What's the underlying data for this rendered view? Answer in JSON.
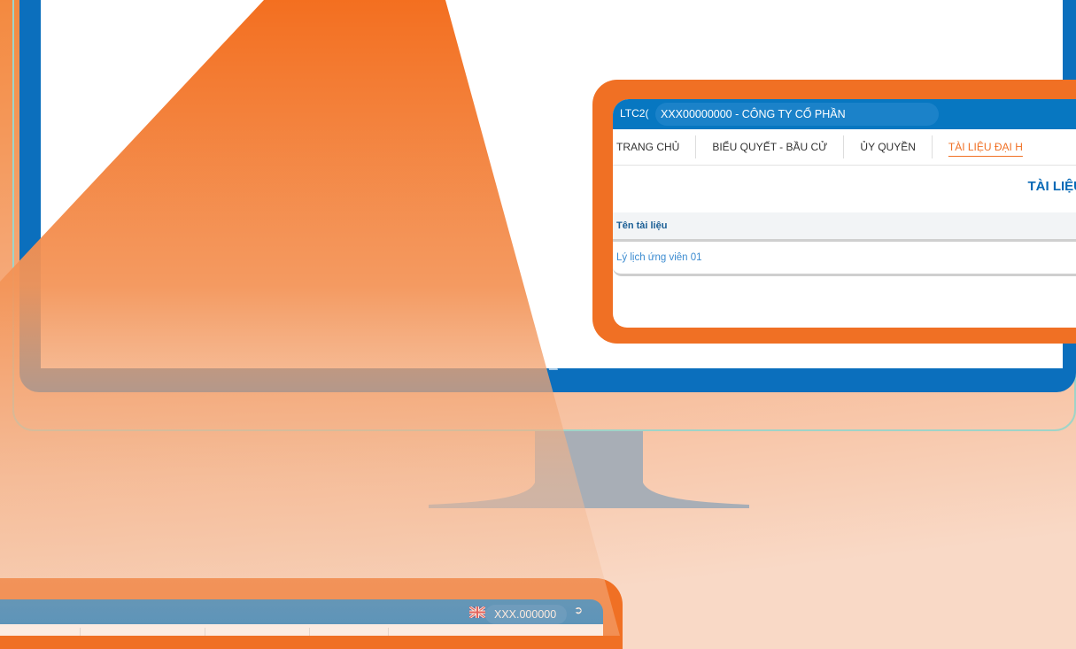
{
  "app": {
    "logo_text": "LTC2(",
    "company": "XXX00000000 - CÔNG TY CỔ PHẦN",
    "nav": [
      "TRANG CHỦ",
      "BIỂU QUYẾT - BẦU CỬ",
      "ỦY QUYỀN",
      "TÀI LIỆU ĐẠI H"
    ],
    "section_title": "TÀI LIỆU ",
    "table": {
      "header": "Tên tài liệu",
      "rows": [
        "Lý lịch ứng viên 01"
      ]
    }
  },
  "bottom_bar": {
    "user": "XXX.000000"
  },
  "colors": {
    "orange": "#f07024",
    "blue": "#0777c1",
    "monitor_blue": "#0b6fbd"
  }
}
